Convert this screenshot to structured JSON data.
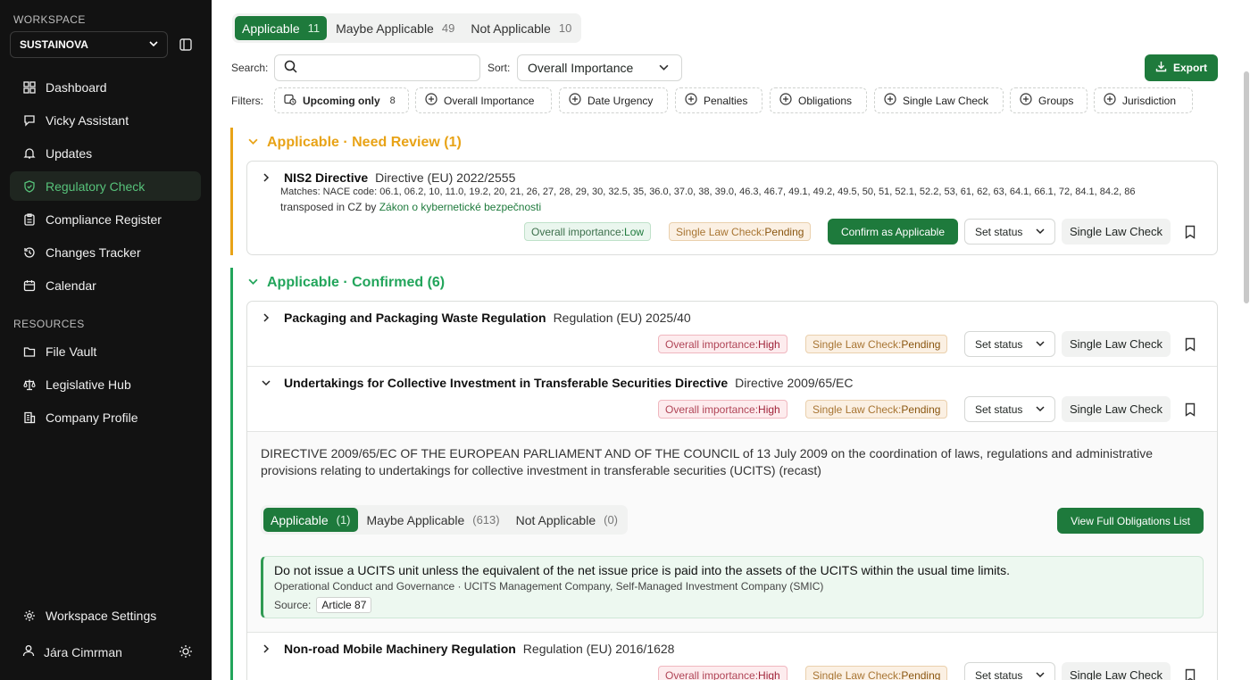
{
  "sidebar": {
    "workspace_label": "WORKSPACE",
    "workspace_name": "SUSTAINOVA",
    "resources_label": "RESOURCES",
    "items": [
      {
        "label": "Dashboard",
        "icon": "dashboard-icon"
      },
      {
        "label": "Vicky Assistant",
        "icon": "chat-icon"
      },
      {
        "label": "Updates",
        "icon": "bell-icon"
      },
      {
        "label": "Regulatory Check",
        "icon": "shield-check-icon",
        "active": true
      },
      {
        "label": "Compliance Register",
        "icon": "clipboard-icon"
      },
      {
        "label": "Changes Tracker",
        "icon": "history-icon"
      },
      {
        "label": "Calendar",
        "icon": "calendar-icon"
      }
    ],
    "resources": [
      {
        "label": "File Vault",
        "icon": "folder-icon"
      },
      {
        "label": "Legislative Hub",
        "icon": "scales-icon"
      },
      {
        "label": "Company Profile",
        "icon": "building-icon"
      }
    ],
    "settings_label": "Workspace Settings",
    "user_name": "Jára Cimrman"
  },
  "tabs": [
    {
      "label": "Applicable",
      "count": "11",
      "active": true
    },
    {
      "label": "Maybe Applicable",
      "count": "49"
    },
    {
      "label": "Not Applicable",
      "count": "10"
    }
  ],
  "toolbar": {
    "search_label": "Search:",
    "search_value": "",
    "sort_label": "Sort:",
    "sort_value": "Overall Importance",
    "export_label": "Export",
    "filters_label": "Filters:"
  },
  "filters": [
    {
      "label": "Upcoming only",
      "count": "8",
      "icon": "calendar-clock-icon"
    },
    {
      "label": "Overall Importance",
      "icon": "plus-circle-icon"
    },
    {
      "label": "Date Urgency",
      "icon": "plus-circle-icon"
    },
    {
      "label": "Penalties",
      "icon": "plus-circle-icon"
    },
    {
      "label": "Obligations",
      "icon": "plus-circle-icon"
    },
    {
      "label": "Single Law Check",
      "icon": "plus-circle-icon"
    },
    {
      "label": "Groups",
      "icon": "plus-circle-icon"
    },
    {
      "label": "Jurisdiction",
      "icon": "plus-circle-icon"
    }
  ],
  "groups": {
    "review": {
      "title": "Applicable · Need Review (1)",
      "color": "#e8a317"
    },
    "confirmed": {
      "title": "Applicable · Confirmed (6)",
      "color": "#22a55b"
    }
  },
  "common": {
    "importance_prefix": "Overall importance: ",
    "slc_prefix": "Single Law Check: ",
    "set_status": "Set status",
    "single_law_check": "Single Law Check",
    "confirm_applicable": "Confirm as Applicable"
  },
  "regs": {
    "nis2": {
      "name": "NIS2 Directive",
      "code": "Directive (EU) 2022/2555",
      "matches": "Matches: NACE code: 06.1, 06.2, 10, 11.0, 19.2, 20, 21, 26, 27, 28, 29, 30, 32.5, 35, 36.0, 37.0, 38, 39.0, 46.3, 46.7, 49.1, 49.2, 49.5, 50, 51, 52.1, 52.2, 53, 61, 62, 63, 64.1, 66.1, 72, 84.1, 84.2, 86",
      "transposed_prefix": "transposed in CZ by ",
      "transposed_law": "Zákon o kybernetické bezpečnosti",
      "importance": "Low",
      "slc": "Pending"
    },
    "packaging": {
      "name": "Packaging and Packaging Waste Regulation",
      "code": "Regulation (EU) 2025/40",
      "importance": "High",
      "slc": "Pending"
    },
    "ucits": {
      "name": "Undertakings for Collective Investment in Transferable Securities Directive",
      "code": "Directive 2009/65/EC",
      "importance": "High",
      "slc": "Pending",
      "description": "DIRECTIVE 2009/65/EC OF THE EUROPEAN PARLIAMENT AND OF THE COUNCIL of 13 July 2009 on the coordination of laws, regulations and administrative provisions relating to undertakings for collective investment in transferable securities (UCITS) (recast)",
      "subtabs": [
        {
          "label": "Applicable",
          "count": "(1)",
          "active": true
        },
        {
          "label": "Maybe Applicable",
          "count": "(613)"
        },
        {
          "label": "Not Applicable",
          "count": "(0)"
        }
      ],
      "view_full": "View Full Obligations List",
      "obligation": {
        "text": "Do not issue a UCITS unit unless the equivalent of the net issue price is paid into the assets of the UCITS within the usual time limits.",
        "meta": "Operational Conduct and Governance  ·  UCITS Management Company, Self-Managed Investment Company (SMIC)",
        "source_label": "Source:",
        "source": "Article 87"
      }
    },
    "nrmm": {
      "name": "Non-road Mobile Machinery Regulation",
      "code": "Regulation (EU) 2016/1628",
      "importance": "High",
      "slc": "Pending"
    }
  }
}
